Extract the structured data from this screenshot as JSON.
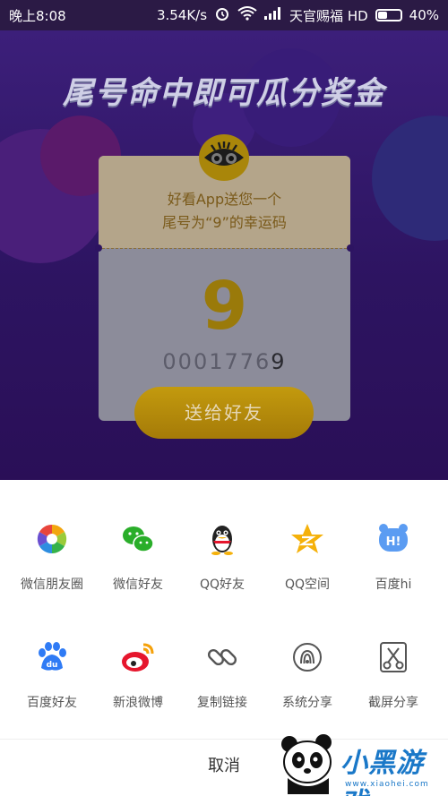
{
  "status_bar": {
    "time": "晚上8:08",
    "network_speed": "3.54K/s",
    "carrier": "天官赐福 HD",
    "battery": "40%",
    "battery_level": 0.4
  },
  "promo": {
    "title": "尾号命中即可瓜分奖金",
    "ticket_line1": "好看App送您一个",
    "ticket_line2": "尾号为“9”的幸运码",
    "lucky_digit": "9",
    "code_prefix": "0001776",
    "code_last": "9",
    "send_button": "送给好友"
  },
  "share_sheet": {
    "row1": [
      {
        "label": "微信朋友圈",
        "icon": "moments-icon"
      },
      {
        "label": "微信好友",
        "icon": "wechat-icon"
      },
      {
        "label": "QQ好友",
        "icon": "qq-icon"
      },
      {
        "label": "QQ空间",
        "icon": "qzone-icon"
      },
      {
        "label": "百度hi",
        "icon": "baidu-hi-icon"
      }
    ],
    "row2": [
      {
        "label": "百度好友",
        "icon": "baidu-paw-icon"
      },
      {
        "label": "新浪微博",
        "icon": "weibo-icon"
      },
      {
        "label": "复制链接",
        "icon": "link-icon"
      },
      {
        "label": "系统分享",
        "icon": "system-share-icon"
      },
      {
        "label": "截屏分享",
        "icon": "screenshot-share-icon"
      }
    ],
    "cancel": "取消"
  },
  "watermark": {
    "text": "小黑游戏",
    "url": "www.xiaohei.com"
  },
  "colors": {
    "promo_bg": "#2d1461",
    "accent_gold": "#a57b08",
    "wechat_green": "#2aae2a",
    "qq_black": "#222222",
    "qzone_yellow": "#f5b10a",
    "baidu_blue": "#2f7bf5",
    "weibo_red": "#e6162d"
  }
}
